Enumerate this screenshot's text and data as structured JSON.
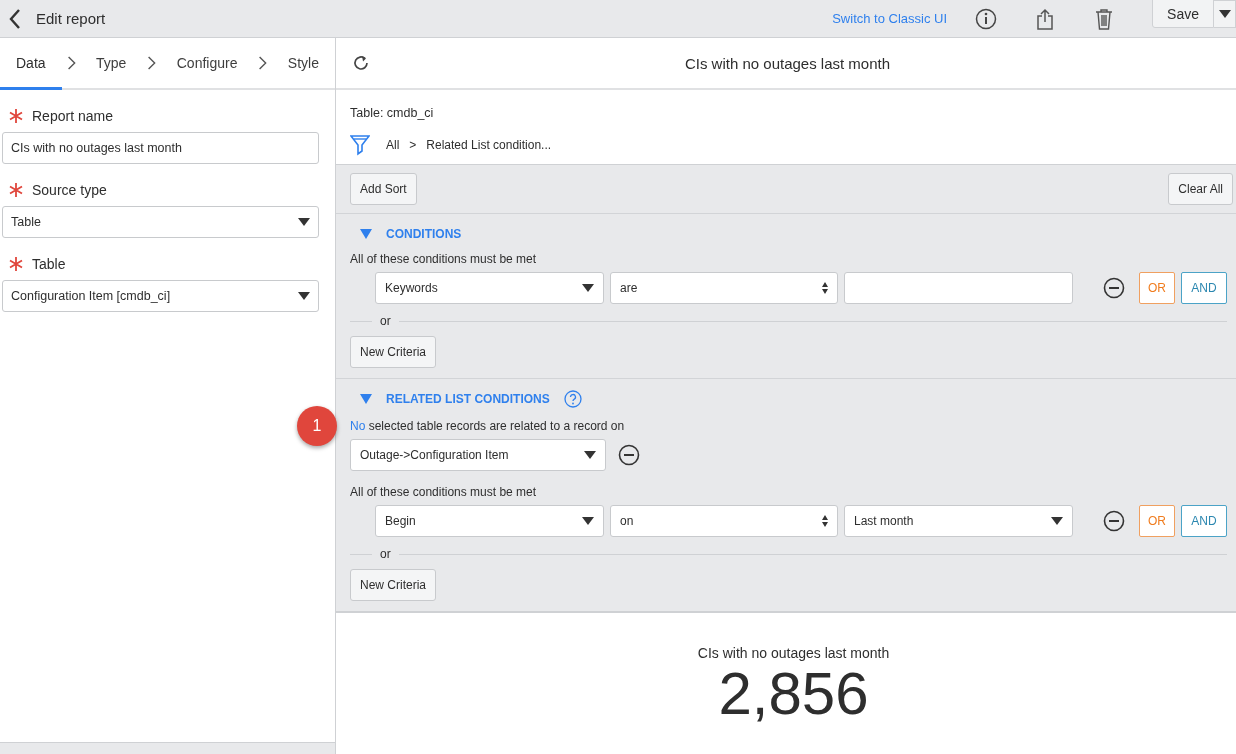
{
  "header": {
    "title": "Edit report",
    "switch_link": "Switch to Classic UI",
    "save": "Save"
  },
  "steps": [
    {
      "label": "Data",
      "selected": true
    },
    {
      "label": "Type",
      "selected": false
    },
    {
      "label": "Configure",
      "selected": false
    },
    {
      "label": "Style",
      "selected": false
    }
  ],
  "fields": [
    {
      "label": "Report name",
      "required": true,
      "kind": "text",
      "value": "CIs with no outages last month"
    },
    {
      "label": "Source type",
      "required": true,
      "kind": "select",
      "value": "Table"
    },
    {
      "label": "Table",
      "required": true,
      "kind": "select",
      "value": "Configuration Item [cmdb_ci]"
    }
  ],
  "report_title": "CIs with no outages last month",
  "table_label": "Table: cmdb_ci",
  "breadcrumb": {
    "items": [
      "All",
      "Related List condition..."
    ],
    "separator": ">"
  },
  "add_sort": "Add Sort",
  "clear_all": "Clear All",
  "conditions": {
    "title": "CONDITIONS",
    "expanded": true,
    "rule_text": "All of these conditions must be met",
    "rows": [
      {
        "field": "Keywords",
        "operator": "are",
        "value": "",
        "kind": "text"
      }
    ],
    "or_label": "or",
    "or_button": "OR",
    "and_button": "AND",
    "new_criteria": "New Criteria"
  },
  "related": {
    "title": "RELATED LIST CONDITIONS",
    "expanded": true,
    "qualifier": "No",
    "intro": "selected table records are related to a record on",
    "relation": "Outage->Configuration Item",
    "rule_text": "All of these conditions must be met",
    "rows": [
      {
        "field": "Begin",
        "operator": "on",
        "value": "Last month",
        "kind": "select"
      }
    ],
    "or_label": "or",
    "or_button": "OR",
    "and_button": "AND",
    "new_criteria": "New Criteria"
  },
  "result": {
    "title": "CIs with no outages last month",
    "value": "2,856"
  },
  "badge": "1"
}
